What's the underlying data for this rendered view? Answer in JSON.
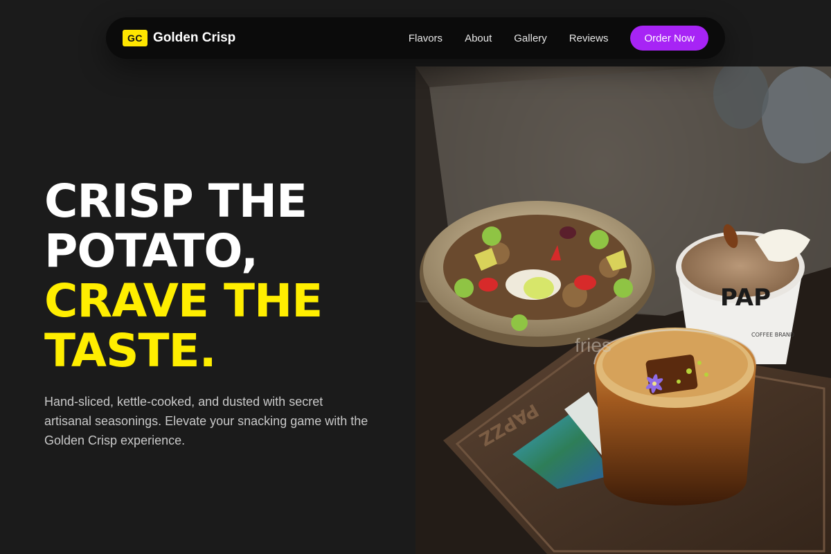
{
  "brand": {
    "badge": "GC",
    "name": "Golden Crisp"
  },
  "nav": {
    "links": [
      "Flavors",
      "About",
      "Gallery",
      "Reviews"
    ],
    "cta_label": "Order Now"
  },
  "hero": {
    "title_lines_white": [
      "Crisp the",
      "potato,"
    ],
    "title_lines_yellow": [
      "crave the",
      "taste."
    ],
    "description": "Hand-sliced, kettle-cooked, and dusted with secret artisanal seasonings. Elevate your snacking game with the Golden Crisp experience."
  },
  "image": {
    "alt": "fries",
    "cup_print": "PAP",
    "cup_subprint": "COFFEE BRAND",
    "tray_print": "PAPZZ"
  },
  "colors": {
    "background": "#1b1b1b",
    "nav_background": "#0b0b0b",
    "accent_yellow": "#ffee00",
    "badge_yellow": "#ffe600",
    "cta_purple": "#a724f5"
  }
}
